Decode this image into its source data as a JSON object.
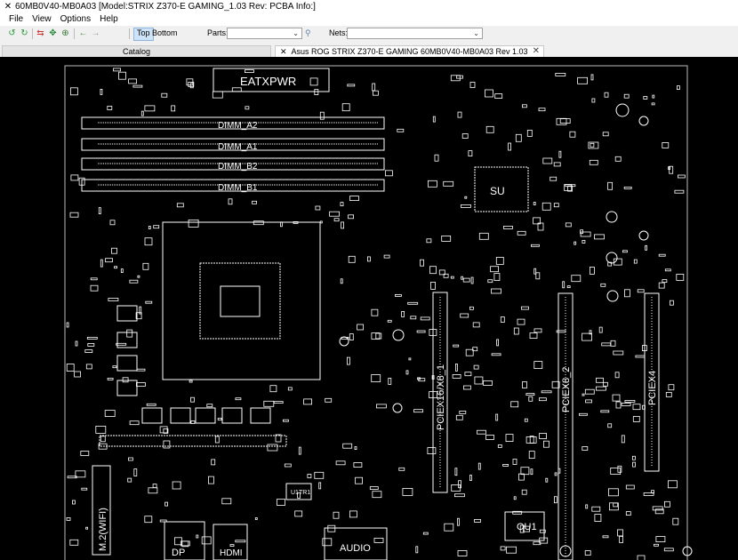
{
  "window": {
    "title": "60MB0V40-MB0A03 [Model:STRIX Z370-E GAMING_1.03 Rev: PCBA Info:]"
  },
  "menu": [
    "File",
    "View",
    "Options",
    "Help"
  ],
  "toolbar": {
    "top_label": "Top",
    "bottom_label": "Bottom",
    "active_side": "Top",
    "parts_label": "Parts:",
    "parts_value": "",
    "nets_label": "Nets:",
    "nets_value": ""
  },
  "tabs": {
    "catalog": "Catalog",
    "board": "Asus ROG STRIX Z370-E GAMING 60MB0V40-MB0A03 Rev 1.03 BoardView",
    "close_glyph": "✕"
  },
  "board": {
    "silkscreen_color": "#ffffff",
    "background": "#000000",
    "labels": {
      "eatxpwr": "EATXPWR",
      "dimm_a2": "DIMM_A2",
      "dimm_a1": "DIMM_A1",
      "dimm_b2": "DIMM_B2",
      "dimm_b1": "DIMM_B1",
      "pciex16_1": "PCIEX16/X8_1",
      "pciex8_2": "PCIEX8_2",
      "pciex4": "PCIEX4",
      "ou1": "OU1",
      "m2wifi": "M.2(WIFI)",
      "dp": "DP",
      "hdmi": "HDMI",
      "audio": "AUDIO",
      "u1tr1": "U1TR1",
      "su": "SU"
    }
  },
  "icons": {
    "app": "board-viewer-icon",
    "toolbar": [
      "rotate-left-icon",
      "rotate-right-icon",
      "flip-icon",
      "fit-icon",
      "zoom-icon",
      "back-arrow-icon",
      "forward-arrow-icon"
    ]
  }
}
